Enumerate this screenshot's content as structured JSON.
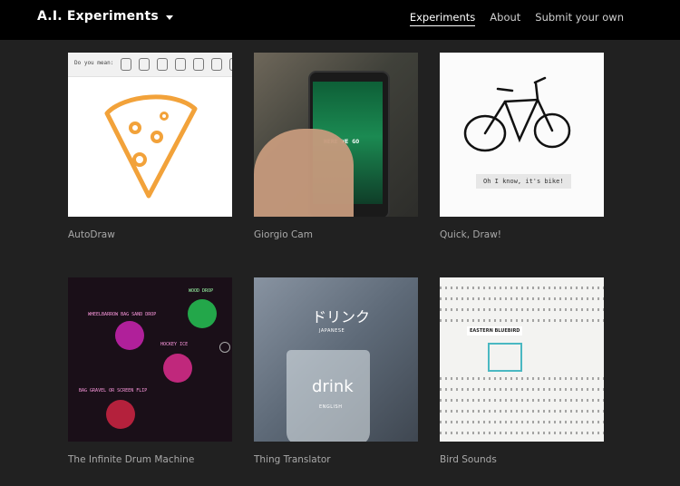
{
  "header": {
    "title": "A.I. Experiments",
    "nav": [
      {
        "label": "Experiments",
        "active": true
      },
      {
        "label": "About",
        "active": false
      },
      {
        "label": "Submit your own",
        "active": false
      }
    ]
  },
  "experiments": [
    {
      "title": "AutoDraw",
      "thumb_text": "Do you mean:"
    },
    {
      "title": "Giorgio Cam",
      "thumb_text": "HERE WE GO"
    },
    {
      "title": "Quick, Draw!",
      "thumb_text": "Oh I know, it's bike!"
    },
    {
      "title": "The Infinite Drum Machine",
      "thumb_labels": [
        "WOOD DROP",
        "WHEELBARROW BAG SAND DROP",
        "HOCKEY ICE",
        "BAG GRAVEL OR SCREEN FLIP"
      ]
    },
    {
      "title": "Thing Translator",
      "thumb_labels": [
        "ドリンク",
        "JAPANESE",
        "drink",
        "ENGLISH"
      ]
    },
    {
      "title": "Bird Sounds",
      "thumb_text": "EASTERN BLUEBIRD"
    }
  ],
  "colors": {
    "background": "#212121",
    "topbar": "#000000",
    "caption": "#a9a9a9",
    "autodraw_pizza": "#f2a23a"
  }
}
